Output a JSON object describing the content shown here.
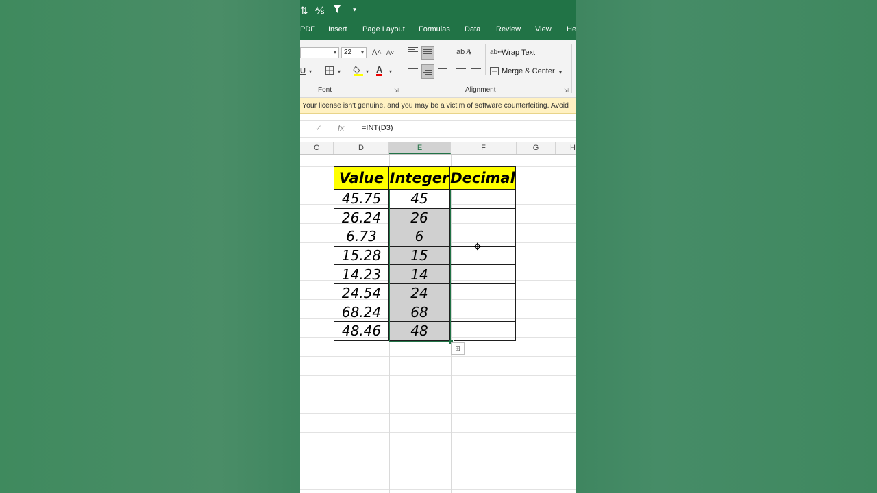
{
  "qat": {
    "sort_icon": "⇅",
    "sort_az_icon": "⅍",
    "filter_icon": "▼",
    "more_icon": "⯆"
  },
  "tabs": [
    "PDF",
    "Insert",
    "Page Layout",
    "Formulas",
    "Data",
    "Review",
    "View",
    "He"
  ],
  "ribbon": {
    "font_size": "22",
    "wrap_text": "Wrap Text",
    "merge_center": "Merge & Center",
    "group_font": "Font",
    "group_alignment": "Alignment",
    "underline_label": "U",
    "font_color_label": "A",
    "grow_font": "A˄",
    "shrink_font": "A˅"
  },
  "warning": "Your license isn't genuine, and you may be a victim of software counterfeiting. Avoid",
  "formula_bar": {
    "check_icon": "✓",
    "fx": "fx",
    "formula": "=INT(D3)"
  },
  "columns": [
    {
      "label": "C",
      "selected": false
    },
    {
      "label": "D",
      "selected": false
    },
    {
      "label": "E",
      "selected": true
    },
    {
      "label": "F",
      "selected": false
    },
    {
      "label": "G",
      "selected": false
    },
    {
      "label": "H",
      "selected": false
    }
  ],
  "table": {
    "headers": [
      "Value",
      "Integer",
      "Decimal"
    ],
    "rows": [
      [
        "45.75",
        "45",
        ""
      ],
      [
        "26.24",
        "26",
        ""
      ],
      [
        "6.73",
        "6",
        ""
      ],
      [
        "15.28",
        "15",
        ""
      ],
      [
        "14.23",
        "14",
        ""
      ],
      [
        "24.54",
        "24",
        ""
      ],
      [
        "68.24",
        "68",
        ""
      ],
      [
        "48.46",
        "48",
        ""
      ]
    ]
  },
  "colors": {
    "excel_green": "#217346",
    "header_fill": "#ffff00",
    "selection_fill": "#d0d0d0"
  },
  "cursor_icon": "✥",
  "quick_analysis_icon": "⊞"
}
